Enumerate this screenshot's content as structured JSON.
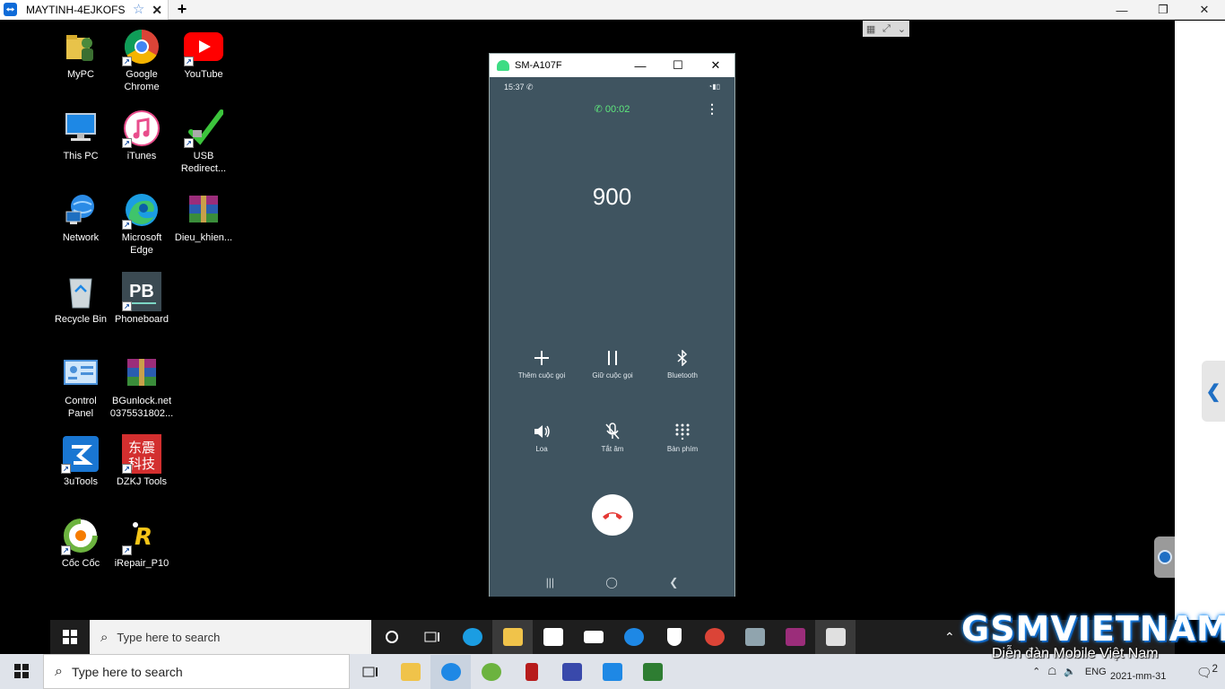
{
  "tab": {
    "title": "MAYTINH-4EJKOFS",
    "star": "☆",
    "close": "✕",
    "add": "+"
  },
  "window_controls": {
    "minimize": "—",
    "maximize": "❐",
    "close": "✕"
  },
  "desktop_icons": [
    {
      "label": "MyPC",
      "icon": "user-folder-icon"
    },
    {
      "label": "Google\nChrome",
      "icon": "chrome-icon"
    },
    {
      "label": "YouTube",
      "icon": "youtube-icon"
    },
    {
      "label": "This PC",
      "icon": "computer-icon"
    },
    {
      "label": "iTunes",
      "icon": "itunes-icon"
    },
    {
      "label": "USB\nRedirect...",
      "icon": "usb-icon"
    },
    {
      "label": "Network",
      "icon": "network-icon"
    },
    {
      "label": "Microsoft\nEdge",
      "icon": "edge-icon"
    },
    {
      "label": "Dieu_khien...",
      "icon": "winrar-icon"
    },
    {
      "label": "Recycle Bin",
      "icon": "recycle-bin-icon"
    },
    {
      "label": "Phoneboard",
      "icon": "phoneboard-icon"
    },
    {
      "label": "Control\nPanel",
      "icon": "control-panel-icon"
    },
    {
      "label": "BGunlock.net\n0375531802...",
      "icon": "winrar-icon"
    },
    {
      "label": "3uTools",
      "icon": "3utools-icon"
    },
    {
      "label": "DZKJ Tools",
      "icon": "dzkj-icon"
    },
    {
      "label": "Cốc Cốc",
      "icon": "coccoc-icon"
    },
    {
      "label": "iRepair_P10",
      "icon": "irepair-icon"
    }
  ],
  "phone": {
    "window_title": "SM-A107F",
    "status_time": "15:37",
    "call_timer": "00:02",
    "number": "900",
    "controls": [
      {
        "label": "Thêm cuộc gọi",
        "icon": "plus-icon"
      },
      {
        "label": "Giữ cuộc gọi",
        "icon": "pause-icon"
      },
      {
        "label": "Bluetooth",
        "icon": "bluetooth-icon"
      },
      {
        "label": "Loa",
        "icon": "speaker-icon"
      },
      {
        "label": "Tắt âm",
        "icon": "mute-icon"
      },
      {
        "label": "Bàn phím",
        "icon": "keypad-icon"
      }
    ]
  },
  "remote_taskbar": {
    "search_placeholder": "Type here to search"
  },
  "local_taskbar": {
    "search_placeholder": "Type here to search",
    "language": "ENG",
    "date": "2021-mm-31",
    "notifications": "2"
  },
  "watermark": {
    "title": "GSMVIETNAM",
    "subtitle": "Diễn đàn Mobile Việt Nam"
  },
  "colors": {
    "phone_bg": "#3f5460",
    "timer": "#5ee87c",
    "end_call": "#e53935"
  }
}
